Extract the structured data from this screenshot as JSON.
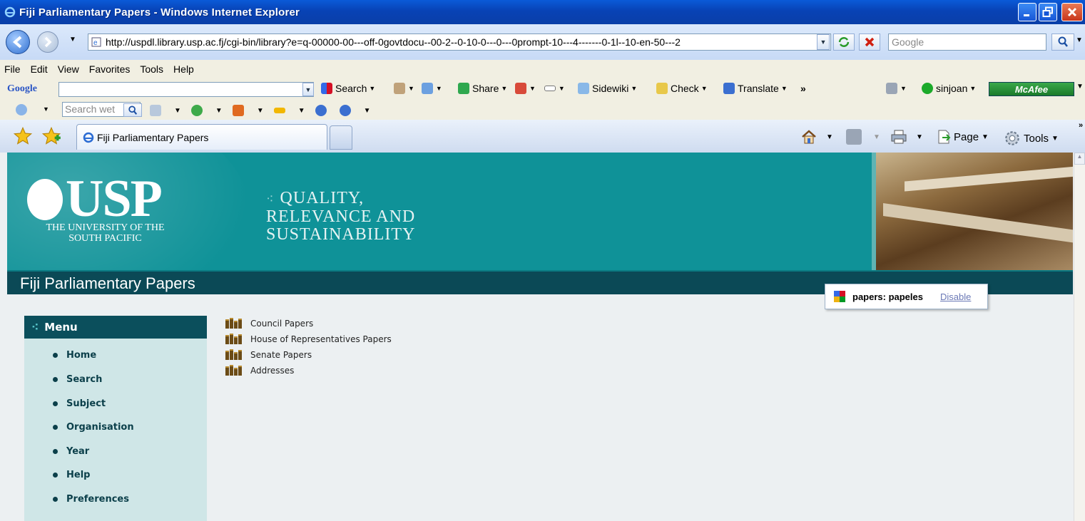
{
  "window": {
    "title": "Fiji Parliamentary Papers - Windows Internet Explorer"
  },
  "address": {
    "url": "http://uspdl.library.usp.ac.fj/cgi-bin/library?e=q-00000-00---off-0govtdocu--00-2--0-10-0---0---0prompt-10---4-------0-1l--10-en-50---2",
    "search_placeholder": "Google"
  },
  "menubar": {
    "items": [
      "File",
      "Edit",
      "View",
      "Favorites",
      "Tools",
      "Help"
    ]
  },
  "googlebar": {
    "logo": "Google",
    "search_label": "Search",
    "share_label": "Share",
    "sidewiki_label": "Sidewiki",
    "check_label": "Check",
    "translate_label": "Translate",
    "more_label": "»",
    "user_label": "sinjoan",
    "mcafee_label": "McAfee"
  },
  "webbar": {
    "search_placeholder": "Search wet"
  },
  "tabs": {
    "active_label": "Fiji Parliamentary Papers"
  },
  "commandbar": {
    "page_label": "Page",
    "tools_label": "Tools",
    "more_label": "»"
  },
  "banner": {
    "logo_text": "USP",
    "university_line1": "THE UNIVERSITY OF THE",
    "university_line2": "SOUTH PACIFIC",
    "tagline_line1": "QUALITY,",
    "tagline_line2": "RELEVANCE AND",
    "tagline_line3": "SUSTAINABILITY",
    "tagline_bullet": "⁖"
  },
  "site": {
    "title": "Fiji Parliamentary Papers"
  },
  "sidebar": {
    "heading": "Menu",
    "items": [
      {
        "label": "Home"
      },
      {
        "label": "Search"
      },
      {
        "label": "Subject"
      },
      {
        "label": "Organisation"
      },
      {
        "label": "Year"
      },
      {
        "label": "Help"
      },
      {
        "label": "Preferences"
      }
    ]
  },
  "collections": [
    {
      "label": "Council Papers"
    },
    {
      "label": "House of Representatives Papers"
    },
    {
      "label": "Senate Papers"
    },
    {
      "label": "Addresses"
    }
  ],
  "translate_popup": {
    "text": "papers: papeles",
    "disable_label": "Disable"
  },
  "colors": {
    "titlebar": "#0842b5",
    "banner_teal": "#0f9298",
    "site_bar": "#0b4956",
    "menu_bg": "#cfe6e7",
    "link_blue": "#6b79b6"
  }
}
